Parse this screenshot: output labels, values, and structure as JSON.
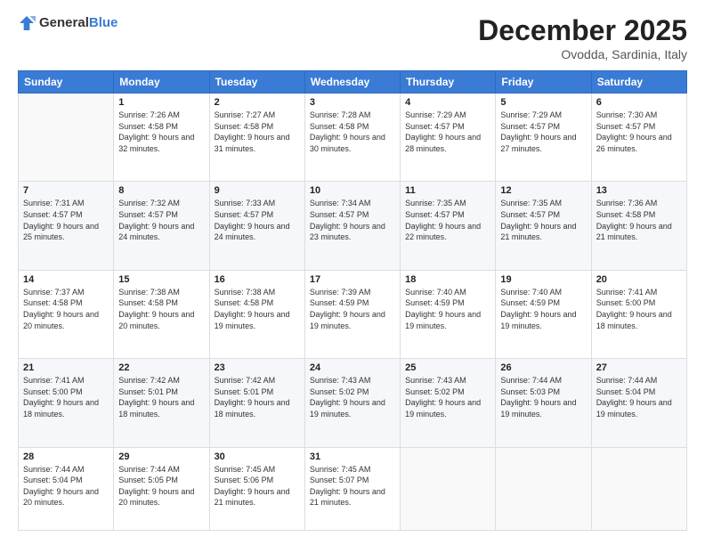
{
  "header": {
    "logo_general": "General",
    "logo_blue": "Blue",
    "month": "December 2025",
    "location": "Ovodda, Sardinia, Italy"
  },
  "weekdays": [
    "Sunday",
    "Monday",
    "Tuesday",
    "Wednesday",
    "Thursday",
    "Friday",
    "Saturday"
  ],
  "weeks": [
    [
      {
        "day": "",
        "sunrise": "",
        "sunset": "",
        "daylight": ""
      },
      {
        "day": "1",
        "sunrise": "Sunrise: 7:26 AM",
        "sunset": "Sunset: 4:58 PM",
        "daylight": "Daylight: 9 hours and 32 minutes."
      },
      {
        "day": "2",
        "sunrise": "Sunrise: 7:27 AM",
        "sunset": "Sunset: 4:58 PM",
        "daylight": "Daylight: 9 hours and 31 minutes."
      },
      {
        "day": "3",
        "sunrise": "Sunrise: 7:28 AM",
        "sunset": "Sunset: 4:58 PM",
        "daylight": "Daylight: 9 hours and 30 minutes."
      },
      {
        "day": "4",
        "sunrise": "Sunrise: 7:29 AM",
        "sunset": "Sunset: 4:57 PM",
        "daylight": "Daylight: 9 hours and 28 minutes."
      },
      {
        "day": "5",
        "sunrise": "Sunrise: 7:29 AM",
        "sunset": "Sunset: 4:57 PM",
        "daylight": "Daylight: 9 hours and 27 minutes."
      },
      {
        "day": "6",
        "sunrise": "Sunrise: 7:30 AM",
        "sunset": "Sunset: 4:57 PM",
        "daylight": "Daylight: 9 hours and 26 minutes."
      }
    ],
    [
      {
        "day": "7",
        "sunrise": "Sunrise: 7:31 AM",
        "sunset": "Sunset: 4:57 PM",
        "daylight": "Daylight: 9 hours and 25 minutes."
      },
      {
        "day": "8",
        "sunrise": "Sunrise: 7:32 AM",
        "sunset": "Sunset: 4:57 PM",
        "daylight": "Daylight: 9 hours and 24 minutes."
      },
      {
        "day": "9",
        "sunrise": "Sunrise: 7:33 AM",
        "sunset": "Sunset: 4:57 PM",
        "daylight": "Daylight: 9 hours and 24 minutes."
      },
      {
        "day": "10",
        "sunrise": "Sunrise: 7:34 AM",
        "sunset": "Sunset: 4:57 PM",
        "daylight": "Daylight: 9 hours and 23 minutes."
      },
      {
        "day": "11",
        "sunrise": "Sunrise: 7:35 AM",
        "sunset": "Sunset: 4:57 PM",
        "daylight": "Daylight: 9 hours and 22 minutes."
      },
      {
        "day": "12",
        "sunrise": "Sunrise: 7:35 AM",
        "sunset": "Sunset: 4:57 PM",
        "daylight": "Daylight: 9 hours and 21 minutes."
      },
      {
        "day": "13",
        "sunrise": "Sunrise: 7:36 AM",
        "sunset": "Sunset: 4:58 PM",
        "daylight": "Daylight: 9 hours and 21 minutes."
      }
    ],
    [
      {
        "day": "14",
        "sunrise": "Sunrise: 7:37 AM",
        "sunset": "Sunset: 4:58 PM",
        "daylight": "Daylight: 9 hours and 20 minutes."
      },
      {
        "day": "15",
        "sunrise": "Sunrise: 7:38 AM",
        "sunset": "Sunset: 4:58 PM",
        "daylight": "Daylight: 9 hours and 20 minutes."
      },
      {
        "day": "16",
        "sunrise": "Sunrise: 7:38 AM",
        "sunset": "Sunset: 4:58 PM",
        "daylight": "Daylight: 9 hours and 19 minutes."
      },
      {
        "day": "17",
        "sunrise": "Sunrise: 7:39 AM",
        "sunset": "Sunset: 4:59 PM",
        "daylight": "Daylight: 9 hours and 19 minutes."
      },
      {
        "day": "18",
        "sunrise": "Sunrise: 7:40 AM",
        "sunset": "Sunset: 4:59 PM",
        "daylight": "Daylight: 9 hours and 19 minutes."
      },
      {
        "day": "19",
        "sunrise": "Sunrise: 7:40 AM",
        "sunset": "Sunset: 4:59 PM",
        "daylight": "Daylight: 9 hours and 19 minutes."
      },
      {
        "day": "20",
        "sunrise": "Sunrise: 7:41 AM",
        "sunset": "Sunset: 5:00 PM",
        "daylight": "Daylight: 9 hours and 18 minutes."
      }
    ],
    [
      {
        "day": "21",
        "sunrise": "Sunrise: 7:41 AM",
        "sunset": "Sunset: 5:00 PM",
        "daylight": "Daylight: 9 hours and 18 minutes."
      },
      {
        "day": "22",
        "sunrise": "Sunrise: 7:42 AM",
        "sunset": "Sunset: 5:01 PM",
        "daylight": "Daylight: 9 hours and 18 minutes."
      },
      {
        "day": "23",
        "sunrise": "Sunrise: 7:42 AM",
        "sunset": "Sunset: 5:01 PM",
        "daylight": "Daylight: 9 hours and 18 minutes."
      },
      {
        "day": "24",
        "sunrise": "Sunrise: 7:43 AM",
        "sunset": "Sunset: 5:02 PM",
        "daylight": "Daylight: 9 hours and 19 minutes."
      },
      {
        "day": "25",
        "sunrise": "Sunrise: 7:43 AM",
        "sunset": "Sunset: 5:02 PM",
        "daylight": "Daylight: 9 hours and 19 minutes."
      },
      {
        "day": "26",
        "sunrise": "Sunrise: 7:44 AM",
        "sunset": "Sunset: 5:03 PM",
        "daylight": "Daylight: 9 hours and 19 minutes."
      },
      {
        "day": "27",
        "sunrise": "Sunrise: 7:44 AM",
        "sunset": "Sunset: 5:04 PM",
        "daylight": "Daylight: 9 hours and 19 minutes."
      }
    ],
    [
      {
        "day": "28",
        "sunrise": "Sunrise: 7:44 AM",
        "sunset": "Sunset: 5:04 PM",
        "daylight": "Daylight: 9 hours and 20 minutes."
      },
      {
        "day": "29",
        "sunrise": "Sunrise: 7:44 AM",
        "sunset": "Sunset: 5:05 PM",
        "daylight": "Daylight: 9 hours and 20 minutes."
      },
      {
        "day": "30",
        "sunrise": "Sunrise: 7:45 AM",
        "sunset": "Sunset: 5:06 PM",
        "daylight": "Daylight: 9 hours and 21 minutes."
      },
      {
        "day": "31",
        "sunrise": "Sunrise: 7:45 AM",
        "sunset": "Sunset: 5:07 PM",
        "daylight": "Daylight: 9 hours and 21 minutes."
      },
      {
        "day": "",
        "sunrise": "",
        "sunset": "",
        "daylight": ""
      },
      {
        "day": "",
        "sunrise": "",
        "sunset": "",
        "daylight": ""
      },
      {
        "day": "",
        "sunrise": "",
        "sunset": "",
        "daylight": ""
      }
    ]
  ]
}
